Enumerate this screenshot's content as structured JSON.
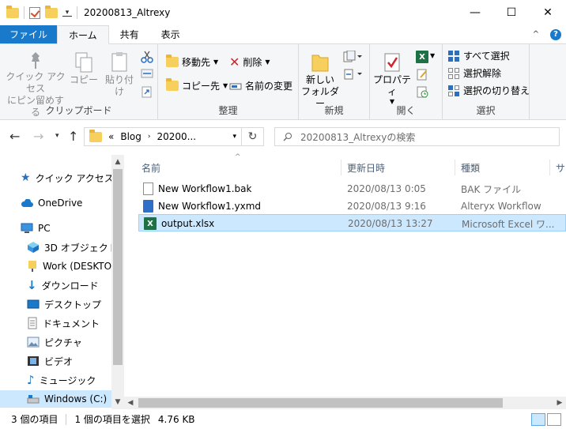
{
  "window": {
    "title": "20200813_Altrexy",
    "minimize": "—",
    "maximize": "☐",
    "close": "✕"
  },
  "tabs": [
    {
      "label": "ファイル"
    },
    {
      "label": "ホーム"
    },
    {
      "label": "共有"
    },
    {
      "label": "表示"
    }
  ],
  "ribbon": {
    "clipboard": {
      "pin_label_1": "クイック アクセス",
      "pin_label_2": "にピン留めする",
      "copy": "コピー",
      "paste": "貼り付け",
      "group": "クリップボード"
    },
    "organize": {
      "move_to": "移動先",
      "copy_to": "コピー先",
      "delete": "削除",
      "rename": "名前の変更",
      "group": "整理"
    },
    "new": {
      "new_folder_1": "新しい",
      "new_folder_2": "フォルダー",
      "group": "新規"
    },
    "open": {
      "properties": "プロパティ",
      "group": "開く"
    },
    "select": {
      "select_all": "すべて選択",
      "select_none": "選択解除",
      "invert": "選択の切り替え",
      "group": "選択"
    }
  },
  "address": {
    "overflow": "«",
    "crumb1": "Blog",
    "crumb2": "20200...",
    "search_placeholder": "20200813_Altrexyの検索"
  },
  "nav_pane": [
    {
      "label": "クイック アクセス",
      "icon": "star-icon"
    },
    {
      "label": "OneDrive",
      "icon": "cloud-icon"
    },
    {
      "label": "PC",
      "icon": "pc-icon"
    },
    {
      "label": "3D オブジェクト",
      "icon": "cube-icon"
    },
    {
      "label": "Work (DESKTOP-",
      "icon": "folder-icon"
    },
    {
      "label": "ダウンロード",
      "icon": "download-icon"
    },
    {
      "label": "デスクトップ",
      "icon": "desktop-icon"
    },
    {
      "label": "ドキュメント",
      "icon": "document-icon"
    },
    {
      "label": "ピクチャ",
      "icon": "picture-icon"
    },
    {
      "label": "ビデオ",
      "icon": "video-icon"
    },
    {
      "label": "ミュージック",
      "icon": "music-icon"
    },
    {
      "label": "Windows (C:)",
      "icon": "drive-icon"
    }
  ],
  "columns": {
    "name": "名前",
    "date": "更新日時",
    "type": "種類",
    "size": "サ"
  },
  "files": [
    {
      "name": "New Workflow1.bak",
      "date": "2020/08/13 0:05",
      "type": "BAK ファイル"
    },
    {
      "name": "New Workflow1.yxmd",
      "date": "2020/08/13 9:16",
      "type": "Alteryx Workflow"
    },
    {
      "name": "output.xlsx",
      "date": "2020/08/13 13:27",
      "type": "Microsoft Excel ワ..."
    }
  ],
  "status": {
    "count": "3 個の項目",
    "selected": "1 個の項目を選択",
    "size": "4.76 KB"
  },
  "colors": {
    "accent": "#1979ca",
    "selection": "#cce8ff",
    "folder": "#f7cf5c",
    "excel": "#1e7145"
  }
}
